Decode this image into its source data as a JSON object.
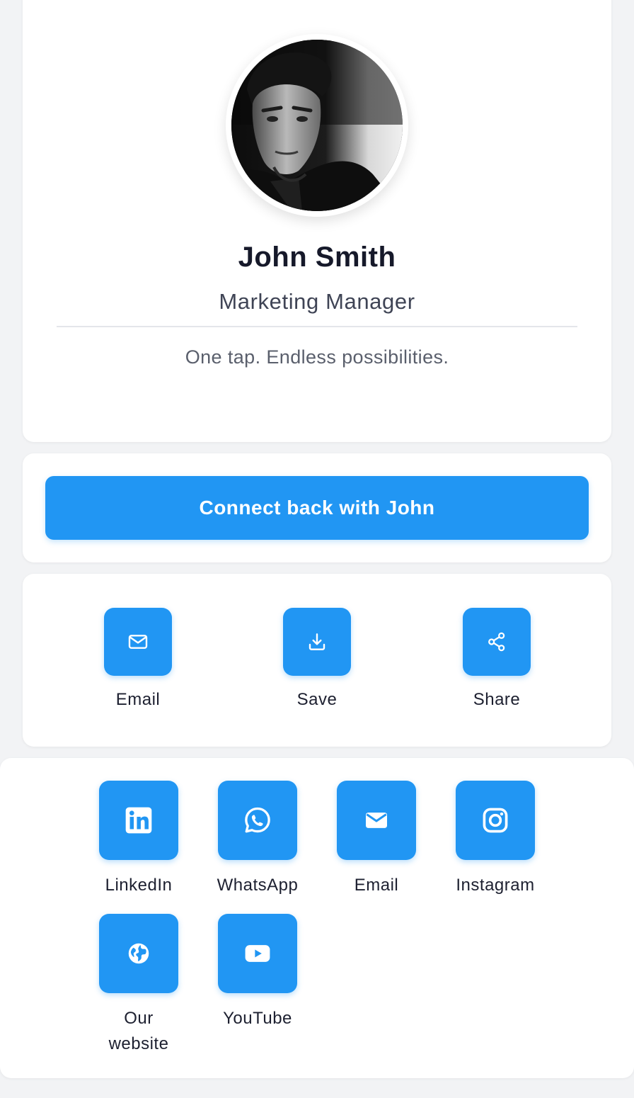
{
  "profile": {
    "name": "John Smith",
    "job_title": "Marketing Manager",
    "tagline": "One tap. Endless possibilities."
  },
  "connect": {
    "button_label": "Connect back with John"
  },
  "actions": [
    {
      "label": "Email",
      "icon": "envelope-outline-icon"
    },
    {
      "label": "Save",
      "icon": "download-icon"
    },
    {
      "label": "Share",
      "icon": "share-icon"
    }
  ],
  "links": [
    {
      "label": "LinkedIn",
      "icon": "linkedin-icon"
    },
    {
      "label": "WhatsApp",
      "icon": "whatsapp-icon"
    },
    {
      "label": "Email",
      "icon": "envelope-filled-icon"
    },
    {
      "label": "Instagram",
      "icon": "instagram-icon"
    },
    {
      "label": "Our website",
      "icon": "globe-icon"
    },
    {
      "label": "YouTube",
      "icon": "youtube-icon"
    }
  ],
  "colors": {
    "accent": "#2196f3",
    "page_background": "#f2f3f5",
    "card_background": "#ffffff",
    "name_text": "#16192a"
  }
}
